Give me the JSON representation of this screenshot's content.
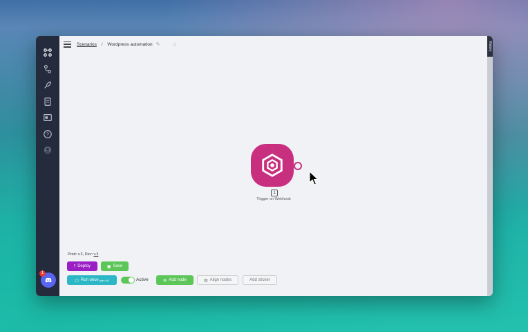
{
  "breadcrumb": {
    "parent": "Scenarios",
    "separator": "/",
    "current": "Wordpress automation"
  },
  "history_tab": "History",
  "node": {
    "number": "1",
    "label": "Trigger on Webhook",
    "color": "#c8307f"
  },
  "footer": {
    "version_prefix": "Prod: v.3, Dev:",
    "version_dev": "v.3"
  },
  "buttons": {
    "deploy": "Deploy",
    "save": "Save",
    "run_once": "Run once",
    "run_once_sup": "(dev.v3)",
    "active_label": "Active",
    "add_node": "Add node",
    "align_nodes": "Align nodes",
    "add_sticker": "Add sticker"
  },
  "discord": {
    "badge": "1"
  },
  "sidebar_icons": [
    "scenarios-icon",
    "nodes-icon",
    "launch-icon",
    "docs-icon",
    "dashboard-icon",
    "help-icon",
    "user-icon"
  ],
  "colors": {
    "sidebar": "#232b3c",
    "deploy": "#9a1fc4",
    "save": "#5cc659",
    "run": "#2bb7c5",
    "node": "#c8307f"
  },
  "toggles": {
    "active": true
  }
}
